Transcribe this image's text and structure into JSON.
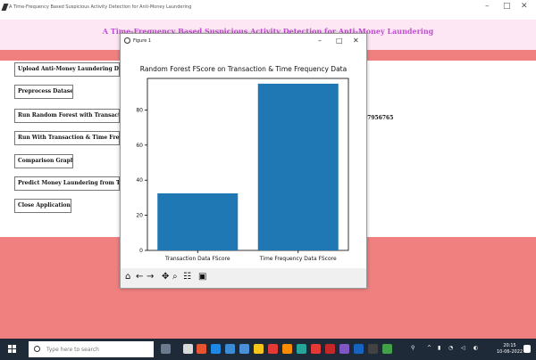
{
  "window": {
    "title": "A Time-Frequency Based Suspicious Activity Detection for Anti-Money Laundering",
    "minimize": "–",
    "maximize": "□",
    "close": "✕"
  },
  "app": {
    "heading": "A Time-Frequency Based Suspicious Activity Detection for Anti-Money Laundering",
    "buttons": [
      "Upload Anti-Money Laundering Dat",
      "Preprocess Dataset",
      "Run Random Forest with Transactic",
      "Run With Transaction & Time Freq",
      "Comparison Graph",
      "Predict Money Laundering from Te",
      "Close Application"
    ],
    "result_text": "57956765"
  },
  "figure": {
    "window_title": "Figure 1",
    "minimize": "–",
    "maximize": "□",
    "close": "✕",
    "toolbar_icons": [
      "home-icon",
      "back-icon",
      "forward-icon",
      "pan-icon",
      "zoom-icon",
      "configure-icon",
      "save-icon"
    ]
  },
  "chart_data": {
    "type": "bar",
    "title": "Random Forest FScore on Transaction & Time Frequency Data",
    "categories": [
      "Transaction Data FScore",
      "Time Frequency Data FScore"
    ],
    "values": [
      32.5,
      95
    ],
    "ylim": [
      0,
      98
    ],
    "yticks": [
      0,
      20,
      40,
      60,
      80
    ],
    "bar_color": "#1f77b4",
    "xlabel": "",
    "ylabel": ""
  },
  "taskbar": {
    "search_placeholder": "Type here to search",
    "time": "20:15",
    "date": "10-06-2022"
  }
}
